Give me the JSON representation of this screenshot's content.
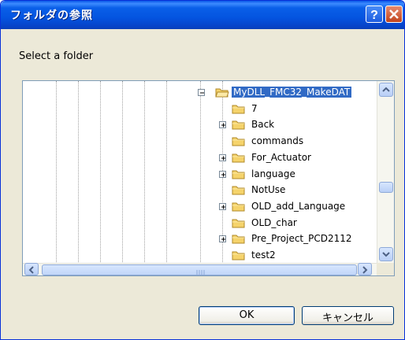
{
  "window": {
    "title": "フォルダの参照"
  },
  "dialog": {
    "prompt": "Select a folder"
  },
  "tree": {
    "root": "MyDLL_FMC32_MakeDAT",
    "items": [
      {
        "label": "7",
        "expandable": false
      },
      {
        "label": "Back",
        "expandable": true
      },
      {
        "label": "commands",
        "expandable": false
      },
      {
        "label": "For_Actuator",
        "expandable": true
      },
      {
        "label": "language",
        "expandable": true
      },
      {
        "label": "NotUse",
        "expandable": false
      },
      {
        "label": "OLD_add_Language",
        "expandable": true
      },
      {
        "label": "OLD_char",
        "expandable": false
      },
      {
        "label": "Pre_Project_PCD2112",
        "expandable": true
      },
      {
        "label": "test2",
        "expandable": false
      }
    ]
  },
  "buttons": {
    "ok": "OK",
    "cancel": "キャンセル"
  },
  "colors": {
    "titlebar": "#0454e0",
    "selection": "#316ac5",
    "folder": "#f5d36b"
  }
}
